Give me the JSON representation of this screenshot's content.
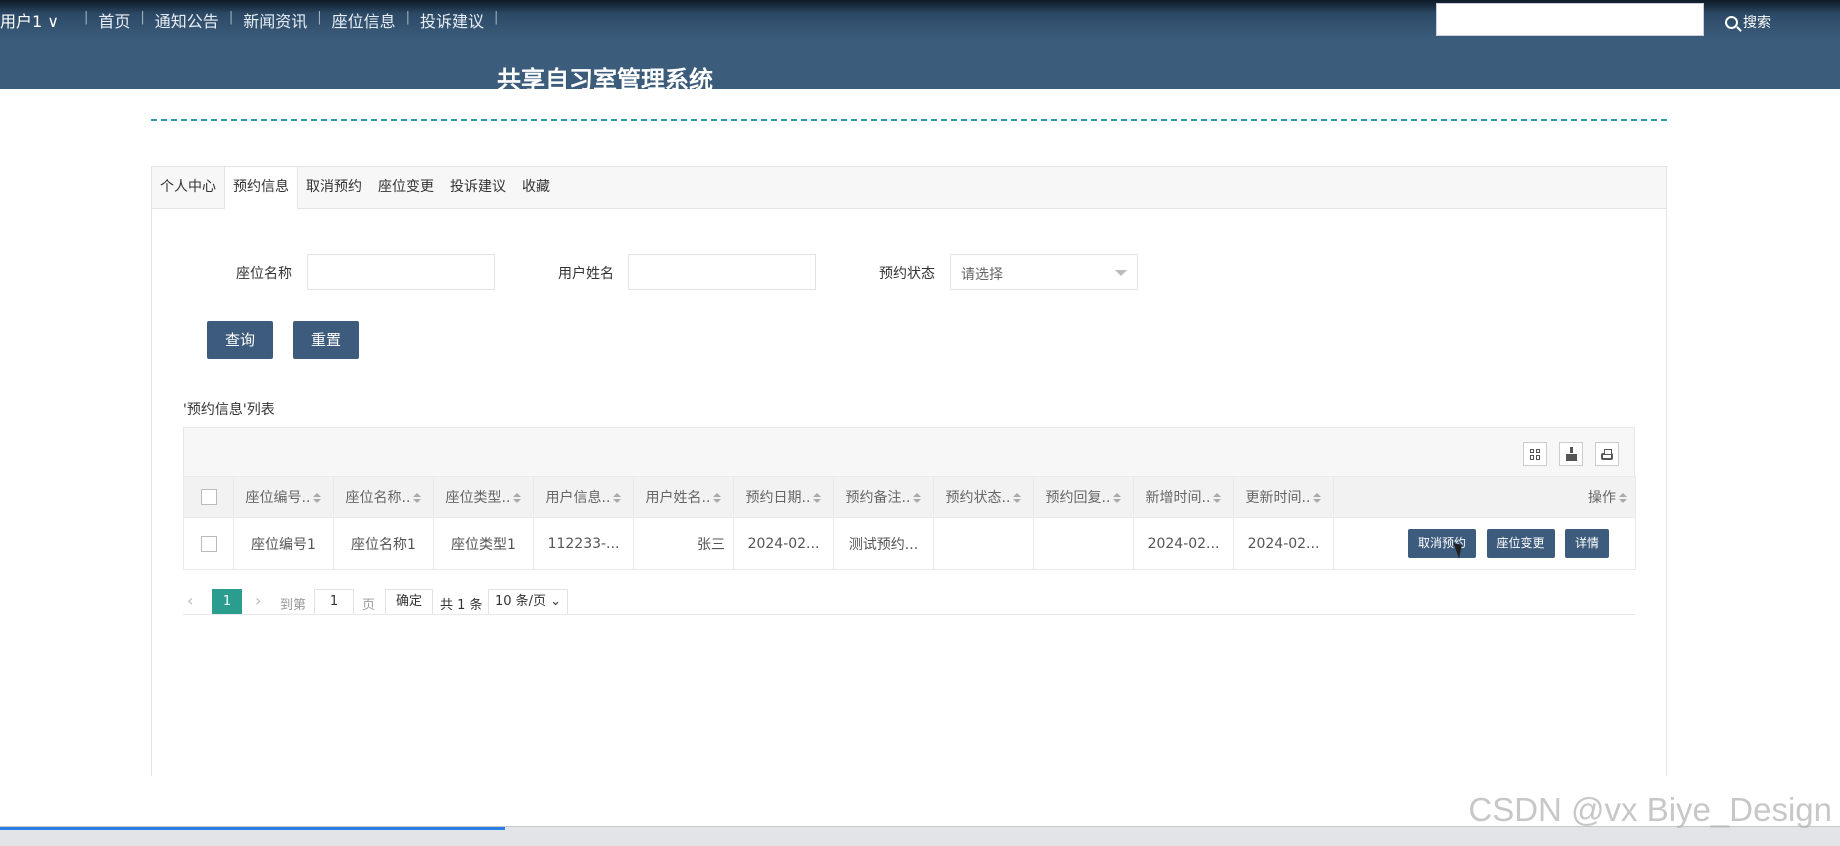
{
  "header": {
    "user_label": "用户1 ∨",
    "nav": [
      "首页",
      "通知公告",
      "新闻资讯",
      "座位信息",
      "投诉建议"
    ],
    "search_placeholder": "",
    "search_label": "搜索",
    "site_title": "共享自习室管理系统"
  },
  "tabs": [
    "个人中心",
    "预约信息",
    "取消预约",
    "座位变更",
    "投诉建议",
    "收藏"
  ],
  "filters": {
    "seat_name_label": "座位名称",
    "user_name_label": "用户姓名",
    "status_label": "预约状态",
    "status_placeholder": "请选择"
  },
  "actions": {
    "query": "查询",
    "reset": "重置"
  },
  "list_title": "'预约信息'列表",
  "table": {
    "columns": [
      "座位编号..",
      "座位名称..",
      "座位类型..",
      "用户信息..",
      "用户姓名..",
      "预约日期..",
      "预约备注..",
      "预约状态..",
      "预约回复..",
      "新增时间..",
      "更新时间..",
      "操作"
    ],
    "rows": [
      {
        "seat_no": "座位编号1",
        "seat_name": "座位名称1",
        "seat_type": "座位类型1",
        "user_info": "112233-...",
        "user_name": "张三",
        "date": "2024-02...",
        "note": "测试预约...",
        "status": "",
        "reply": "",
        "created": "2024-02...",
        "updated": "2024-02...",
        "btn_cancel": "取消预约",
        "btn_change": "座位变更",
        "btn_detail": "详情"
      }
    ]
  },
  "pager": {
    "current": "1",
    "goto_prefix": "到第",
    "page_input": "1",
    "page_suffix": "页",
    "confirm": "确定",
    "total": "共 1 条",
    "page_size": "10 条/页 ⌄"
  },
  "watermark": "CSDN @vx Biye_Design",
  "colors": {
    "header_bg": "#3c5c7c",
    "button": "#3d5b7c",
    "accent": "#2a9d8f"
  }
}
